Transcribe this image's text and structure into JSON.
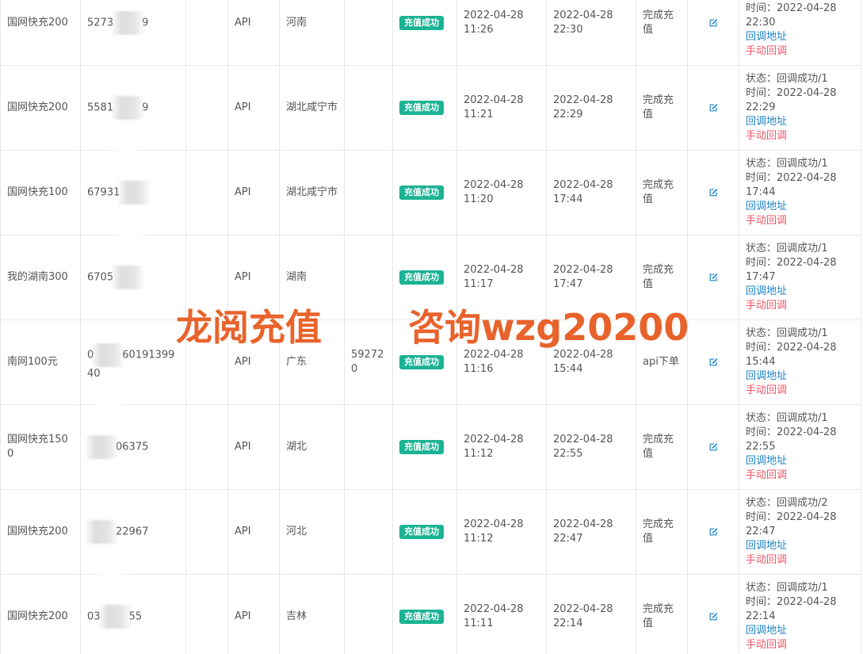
{
  "watermark": {
    "left": "龙阅充值",
    "right": "咨询wzg20200"
  },
  "callback": {
    "status_prefix": "状态：",
    "time_prefix": "时间：",
    "url_label": "回调地址",
    "manual_label": "手动回调"
  },
  "rows": [
    {
      "product": "国网快充200",
      "account_pre": "5273",
      "account_post": "9",
      "channel": "API",
      "region": "河南",
      "extra": "",
      "status": "充值成功",
      "created_date": "2022-04-28",
      "created_time": "11:26",
      "finished_date": "2022-04-28",
      "finished_time": "22:30",
      "result": "完成充值",
      "cb_status": "",
      "cb_time_date": "2022-04-28",
      "cb_time_time": "22:30"
    },
    {
      "product": "国网快充200",
      "account_pre": "5581",
      "account_post": "9",
      "channel": "API",
      "region": "湖北咸宁市",
      "extra": "",
      "status": "充值成功",
      "created_date": "2022-04-28",
      "created_time": "11:21",
      "finished_date": "2022-04-28",
      "finished_time": "22:29",
      "result": "完成充值",
      "cb_status": "回调成功/1",
      "cb_time_date": "2022-04-28",
      "cb_time_time": "22:29"
    },
    {
      "product": "国网快充100",
      "account_pre": "67931",
      "account_post": "",
      "channel": "API",
      "region": "湖北咸宁市",
      "extra": "",
      "status": "充值成功",
      "created_date": "2022-04-28",
      "created_time": "11:20",
      "finished_date": "2022-04-28",
      "finished_time": "17:44",
      "result": "完成充值",
      "cb_status": "回调成功/1",
      "cb_time_date": "2022-04-28",
      "cb_time_time": "17:44"
    },
    {
      "product": "我的湖南300",
      "account_pre": "6705",
      "account_post": "",
      "channel": "API",
      "region": "湖南",
      "extra": "",
      "status": "充值成功",
      "created_date": "2022-04-28",
      "created_time": "11:17",
      "finished_date": "2022-04-28",
      "finished_time": "17:47",
      "result": "完成充值",
      "cb_status": "回调成功/1",
      "cb_time_date": "2022-04-28",
      "cb_time_time": "17:47"
    },
    {
      "product": "南网100元",
      "account_pre": "0",
      "account_post": "6019139940",
      "channel": "API",
      "region": "广东",
      "extra": "592720",
      "status": "充值成功",
      "created_date": "2022-04-28",
      "created_time": "11:16",
      "finished_date": "2022-04-28",
      "finished_time": "15:44",
      "result": "api下单",
      "cb_status": "回调成功/1",
      "cb_time_date": "2022-04-28",
      "cb_time_time": "15:44"
    },
    {
      "product": "国网快充1500",
      "account_pre": "",
      "account_post": "06375",
      "channel": "API",
      "region": "湖北",
      "extra": "",
      "status": "充值成功",
      "created_date": "2022-04-28",
      "created_time": "11:12",
      "finished_date": "2022-04-28",
      "finished_time": "22:55",
      "result": "完成充值",
      "cb_status": "回调成功/1",
      "cb_time_date": "2022-04-28",
      "cb_time_time": "22:55"
    },
    {
      "product": "国网快充200",
      "account_pre": "",
      "account_post": "22967",
      "channel": "API",
      "region": "河北",
      "extra": "",
      "status": "充值成功",
      "created_date": "2022-04-28",
      "created_time": "11:12",
      "finished_date": "2022-04-28",
      "finished_time": "22:47",
      "result": "完成充值",
      "cb_status": "回调成功/2",
      "cb_time_date": "2022-04-28",
      "cb_time_time": "22:47"
    },
    {
      "product": "国网快充200",
      "account_pre": "03",
      "account_post": "55",
      "channel": "API",
      "region": "吉林",
      "extra": "",
      "status": "充值成功",
      "created_date": "2022-04-28",
      "created_time": "11:11",
      "finished_date": "2022-04-28",
      "finished_time": "22:14",
      "result": "完成充值",
      "cb_status": "回调成功/1",
      "cb_time_date": "2022-04-28",
      "cb_time_time": "22:14"
    }
  ]
}
